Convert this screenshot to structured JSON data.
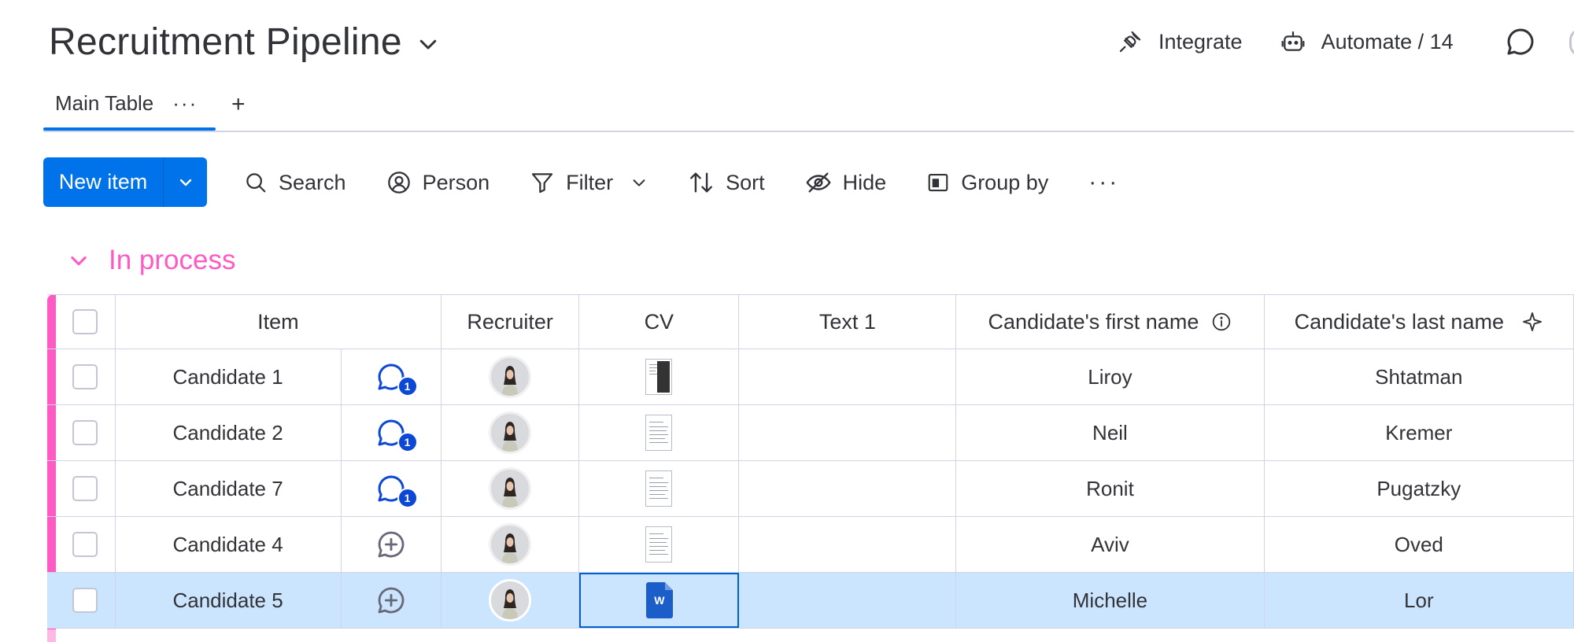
{
  "board": {
    "title": "Recruitment Pipeline"
  },
  "top_actions": {
    "integrate": "Integrate",
    "automate": "Automate / 14"
  },
  "tabs": [
    {
      "label": "Main Table",
      "more": "···"
    }
  ],
  "tab_add": "+",
  "toolbar": {
    "new_item": "New item",
    "search": "Search",
    "person": "Person",
    "filter": "Filter",
    "sort": "Sort",
    "hide": "Hide",
    "group_by": "Group by",
    "more": "···"
  },
  "group": {
    "title": "In process",
    "color": "#ff5ac4"
  },
  "columns": {
    "item": "Item",
    "recruiter": "Recruiter",
    "cv": "CV",
    "text1": "Text 1",
    "first_name": "Candidate's first name",
    "last_name": "Candidate's last name"
  },
  "rows": [
    {
      "item": "Candidate 1",
      "updates": "1",
      "first": "Liroy",
      "last": "Shtatman"
    },
    {
      "item": "Candidate 2",
      "updates": "1",
      "first": "Neil",
      "last": "Kremer"
    },
    {
      "item": "Candidate 7",
      "updates": "1",
      "first": "Ronit",
      "last": "Pugatzky"
    },
    {
      "item": "Candidate 4",
      "updates": "",
      "first": "Aviv",
      "last": "Oved"
    },
    {
      "item": "Candidate 5",
      "updates": "",
      "first": "Michelle",
      "last": "Lor"
    }
  ],
  "cv_file_letter": "W",
  "colors": {
    "accent": "#0073ea",
    "selected_row": "#cce5ff",
    "badge": "#0d47d6"
  }
}
